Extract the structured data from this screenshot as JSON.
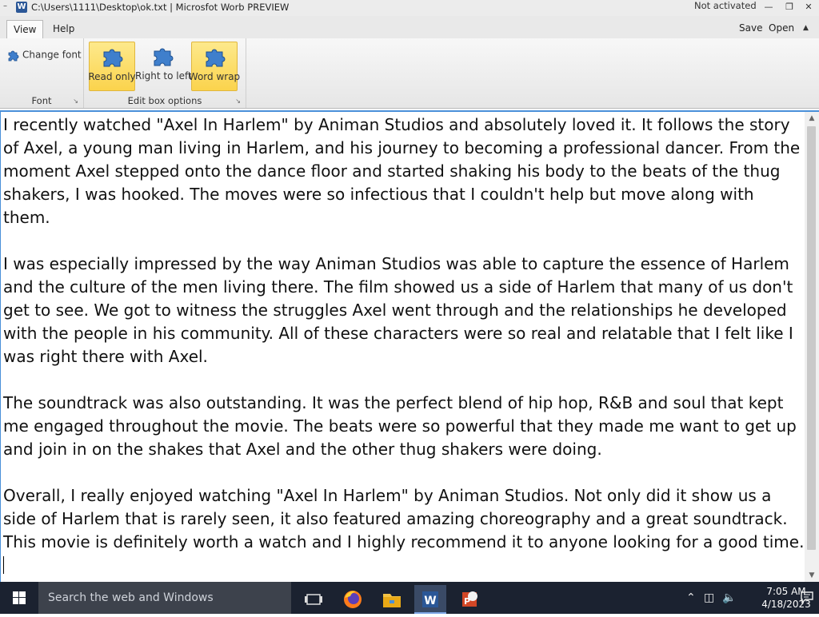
{
  "titlebar": {
    "menu_glyph": "–",
    "app_icon_letter": "W",
    "title": "C:\\Users\\1111\\Desktop\\ok.txt | Microsfot Worb PREVIEW",
    "status": "Not activated"
  },
  "tabs": [
    {
      "label": "View"
    },
    {
      "label": "Help"
    }
  ],
  "tab_actions": {
    "save": "Save",
    "open": "Open"
  },
  "ribbon": {
    "font_group": {
      "label": "Font",
      "change_font": "Change font"
    },
    "edit_group": {
      "label": "Edit box options",
      "buttons": [
        {
          "label": "Read only",
          "active": true
        },
        {
          "label": "Right to left",
          "active": false
        },
        {
          "label": "Word wrap",
          "active": true
        }
      ]
    }
  },
  "editor": {
    "paragraphs": [
      "I recently watched \"Axel In Harlem\" by Animan Studios and absolutely loved it. It follows the story of Axel, a young man living in Harlem, and his journey to becoming a professional dancer. From the moment Axel stepped onto the dance floor and started shaking his body to the beats of the thug shakers, I was hooked. The moves were so infectious that I couldn't help but move along with them.",
      "I was especially impressed by the way Animan Studios was able to capture the essence of Harlem and the culture of the men living there. The film showed us a side of Harlem that many of us don't get to see. We got to witness the struggles Axel went through and the relationships he developed with the people in his community. All of these characters were so real and relatable that I felt like I was right there with Axel.",
      "The soundtrack was also outstanding. It was the perfect blend of hip hop, R&B and soul that kept me engaged throughout the movie. The beats were so powerful that they made me want to get up and join in on the shakes that Axel and the other thug shakers were doing.",
      "Overall, I really enjoyed watching \"Axel In Harlem\" by Animan Studios. Not only did it show us a side of Harlem that is rarely seen, it also featured amazing choreography and a great soundtrack. This movie is definitely worth a watch and I highly recommend it to anyone looking for a good time."
    ]
  },
  "taskbar": {
    "search_placeholder": "Search the web and Windows",
    "time": "7:05 AM",
    "date": "4/18/2023",
    "pinned": [
      "task-view",
      "firefox",
      "file-explorer",
      "word",
      "powerpoint"
    ]
  },
  "colors": {
    "accent": "#4a90d9",
    "toggle_on": "#fbd34c",
    "taskbar": "#1b2230"
  }
}
